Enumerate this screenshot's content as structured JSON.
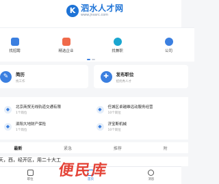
{
  "header": {
    "logo_mark": "K",
    "site_name": "泗水人才网",
    "site_url": "www.jnssrc.com"
  },
  "quick_links": [
    {
      "label": "找招聘",
      "color": "#3b7fe0"
    },
    {
      "label": "精选企业",
      "color": "#f06a4a"
    },
    {
      "label": "找兼职",
      "color": "#1aa6d0"
    },
    {
      "label": "公司",
      "color": "#3b7fe0"
    }
  ],
  "carousel": {
    "active_dot": 0
  },
  "cards": [
    {
      "title": "简历",
      "subtitle": "找工作",
      "icon_color": "#3b7fe0",
      "icon": "doc-icon"
    },
    {
      "title": "发布职位",
      "subtitle": "招优秀人才",
      "icon_color": "#3b7fe0",
      "icon": "post-icon"
    }
  ],
  "companies": [
    {
      "name": "北京商贸无线轨道交通有限",
      "count": "1个岗位"
    },
    {
      "name": "任城区卓越维远动服务经营",
      "count": "10个岗位"
    },
    {
      "name": "泗阳大地财产保险",
      "count": "1个岗位"
    },
    {
      "name": "济宝斯机械",
      "count": "10个岗位"
    }
  ],
  "tabs": [
    {
      "label": "最新",
      "active": true
    },
    {
      "label": "紧急",
      "active": false
    },
    {
      "label": "推荐",
      "active": false
    },
    {
      "label": "附",
      "active": false
    }
  ],
  "job_line": "天，西，经开区，用二十大工",
  "bottom_nav": [
    {
      "label": "职位",
      "active": false
    },
    {
      "label": "首页",
      "active": true
    },
    {
      "label": "消息",
      "active": false
    }
  ],
  "watermark": "便民库"
}
